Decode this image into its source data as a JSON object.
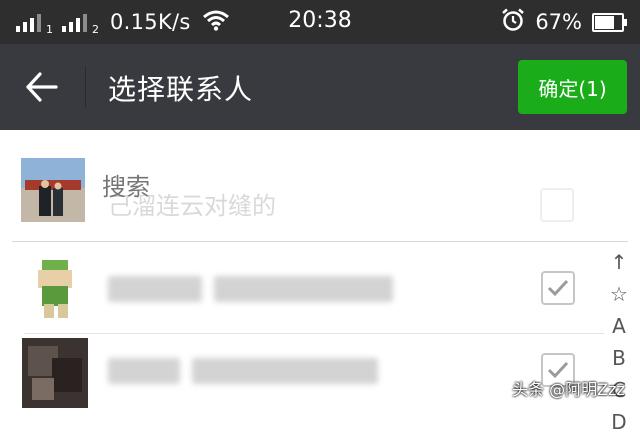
{
  "status_bar": {
    "sim1": "1",
    "sim2": "2",
    "net_speed": "0.15K/s",
    "time": "20:38",
    "battery_percent": "67%",
    "battery_level": 0.67,
    "icons": [
      "signal-icon",
      "wifi-icon",
      "alarm-icon",
      "battery-icon"
    ]
  },
  "header": {
    "back_icon": "arrow-left-icon",
    "title": "选择联系人",
    "confirm_label": "确定(1)"
  },
  "selected": {
    "search_placeholder": "搜索",
    "ghost_contact_name": "己溜连云对缝的"
  },
  "contacts": [
    {
      "name_blurred": true,
      "checked": true
    },
    {
      "name_blurred": true,
      "checked": true
    }
  ],
  "index_bar": [
    "↑",
    "☆",
    "A",
    "B",
    "C",
    "D"
  ],
  "watermark": "头条 @阿明Zzz",
  "colors": {
    "header_bg": "#393a3f",
    "status_bg": "#2e2e2e",
    "confirm_green": "#1aad19",
    "text_gray": "#bdbdbd"
  }
}
